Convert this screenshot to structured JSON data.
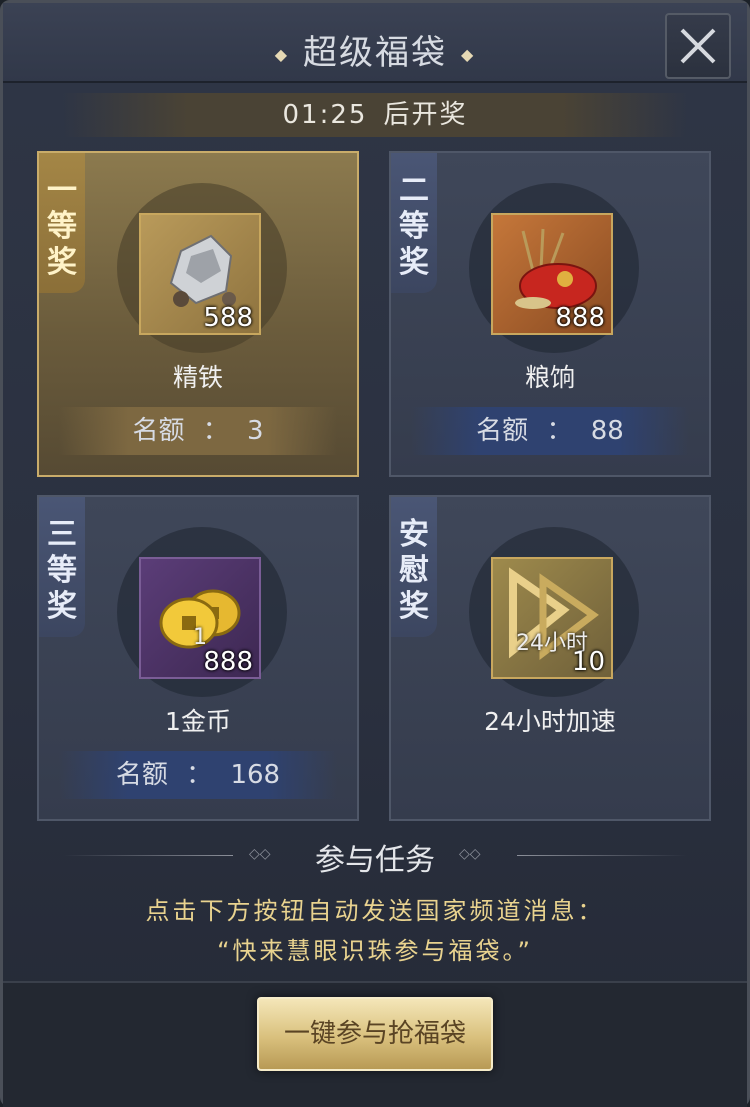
{
  "header": {
    "title": "超级福袋",
    "close_icon": "close-icon"
  },
  "timer": {
    "time": "01:25",
    "suffix": "后开奖"
  },
  "prizes": [
    {
      "rank": "一等奖",
      "item_name": "精铁",
      "count": "588",
      "quota_label": "名额",
      "quota_sep": "：",
      "quota_value": "3",
      "icon": "iron-ore-icon"
    },
    {
      "rank": "二等奖",
      "item_name": "粮饷",
      "count": "888",
      "quota_label": "名额",
      "quota_sep": "：",
      "quota_value": "88",
      "icon": "grain-sack-icon"
    },
    {
      "rank": "三等奖",
      "item_name": "1金币",
      "overlay": "1",
      "count": "888",
      "quota_label": "名额",
      "quota_sep": "：",
      "quota_value": "168",
      "icon": "gold-coin-icon"
    },
    {
      "rank": "安慰奖",
      "item_name": "24小时加速",
      "overlay": "24小时",
      "count": "10",
      "icon": "speedup-icon"
    }
  ],
  "task": {
    "title": "参与任务",
    "line1": "点击下方按钮自动发送国家频道消息：",
    "line2": "“快来慧眼识珠参与福袋。”"
  },
  "button": {
    "label": "一键参与抢福袋"
  },
  "colors": {
    "gold_card": "#8c7a4e",
    "blue_card": "#3f4759",
    "task_text": "#e9d38f"
  }
}
